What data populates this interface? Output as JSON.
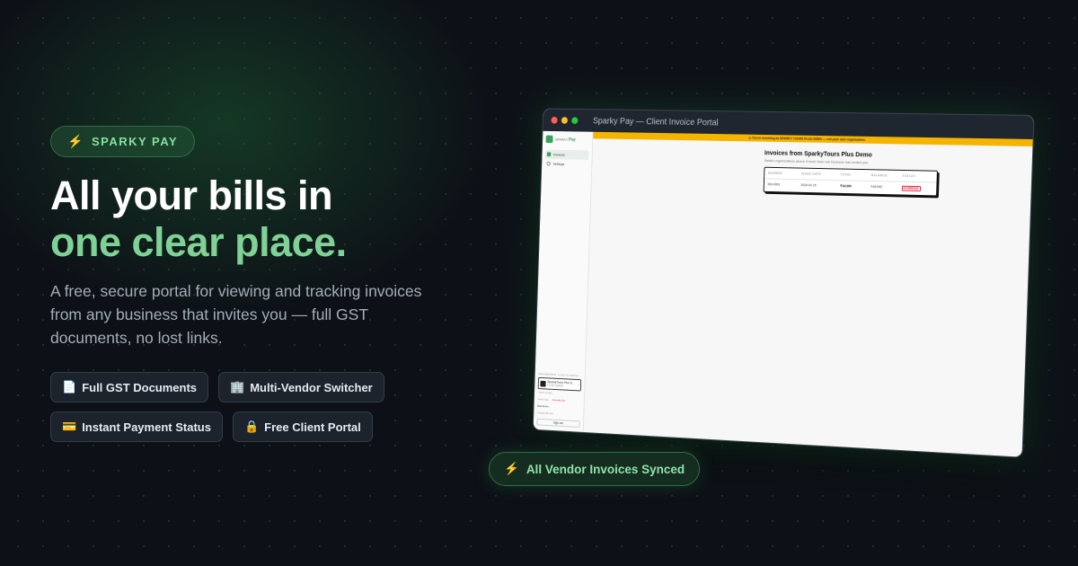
{
  "badge": {
    "icon": "bolt-icon",
    "label": "SPARKY PAY"
  },
  "headline": {
    "line1": "All your bills in",
    "line2": "one clear place."
  },
  "subtext": "A free, secure portal for viewing and tracking invoices from any business that invites you — full GST documents, no lost links.",
  "features": [
    {
      "icon": "📄",
      "label": "Full GST Documents"
    },
    {
      "icon": "🏢",
      "label": "Multi-Vendor Switcher"
    },
    {
      "icon": "💳",
      "label": "Instant Payment Status"
    },
    {
      "icon": "🔒",
      "label": "Free Client Portal"
    }
  ],
  "window": {
    "title": "Sparky Pay — Client Invoice Portal",
    "sidebar": {
      "brand_prefix": "SPARKY",
      "brand": "Pay",
      "items": [
        {
          "label": "Invoices"
        },
        {
          "label": "Settings"
        }
      ],
      "org_caption": "ORGANIZATION · CLICK TO SWITCH",
      "org_name": "SparkyTours Plus D...",
      "org_tag": "CUSTOMER",
      "gst_line": "• GST: 27ABC...",
      "status1": "Verify login",
      "status2": "Unverify link",
      "user_name": "Max Ernes",
      "user_email": "max@mail.com",
      "signout": "Sign out"
    },
    "banner": "⚠ You're invoicing as SPARKY TOURS PLUS DEMO — not your own organization.",
    "main": {
      "title": "Invoices from SparkyTours Plus Demo",
      "subtitle": "Switch organizations above if more than one business has invited you.",
      "columns": [
        "NUMBER",
        "ISSUE DATE",
        "TOTAL",
        "BALANCE",
        "STATUS"
      ],
      "rows": [
        {
          "number": "INV-0001",
          "date": "2026-02-15",
          "total": "₹18,900",
          "balance": "₹18,900",
          "status": "OVERDUE"
        }
      ]
    }
  },
  "synced_pill": {
    "icon": "bolt-icon",
    "label": "All Vendor Invoices Synced"
  },
  "colors": {
    "accent_green": "#7fd195",
    "bolt_yellow": "#f5c542",
    "banner_yellow": "#f5b400",
    "overdue_red": "#e0243a"
  }
}
